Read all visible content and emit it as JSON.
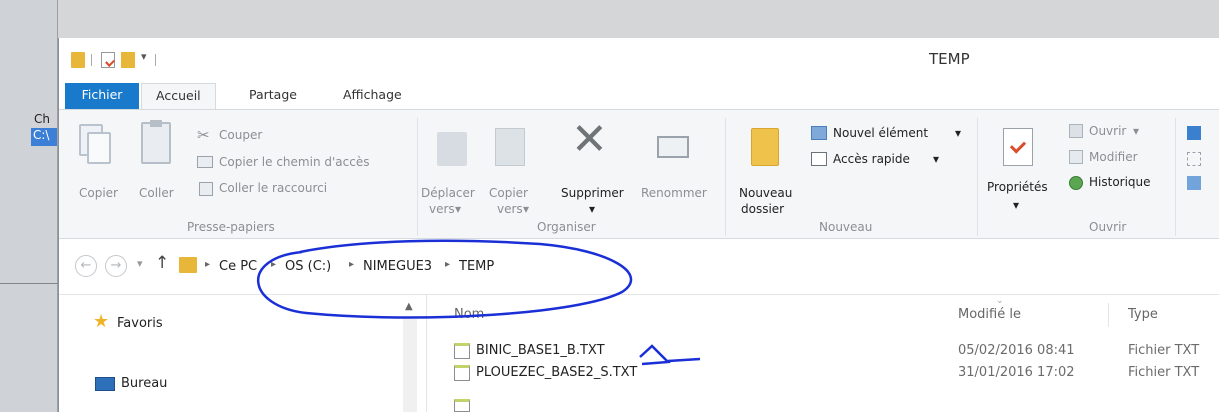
{
  "window": {
    "title": "TEMP"
  },
  "background_app": {
    "label": "Ch",
    "selected": "C:\\"
  },
  "tabs": [
    {
      "label": "Fichier"
    },
    {
      "label": "Accueil"
    },
    {
      "label": "Partage"
    },
    {
      "label": "Affichage"
    }
  ],
  "ribbon": {
    "clipboard": {
      "copy": "Copier",
      "paste": "Coller",
      "cut": "Couper",
      "copy_path": "Copier le chemin d'accès",
      "paste_shortcut": "Coller le raccourci",
      "group": "Presse-papiers"
    },
    "organize": {
      "move_line1": "Déplacer",
      "move_line2": "vers",
      "copy_line1": "Copier",
      "copy_line2": "vers",
      "delete": "Supprimer",
      "rename": "Renommer",
      "group": "Organiser"
    },
    "new": {
      "folder_line1": "Nouveau",
      "folder_line2": "dossier",
      "new_item": "Nouvel élément",
      "quick_access": "Accès rapide",
      "group": "Nouveau"
    },
    "open": {
      "properties": "Propriétés",
      "open": "Ouvrir",
      "edit": "Modifier",
      "history": "Historique",
      "group": "Ouvrir"
    }
  },
  "address": {
    "crumbs": [
      "Ce PC",
      "OS (C:)",
      "NIMEGUE3",
      "TEMP"
    ]
  },
  "nav": {
    "items": [
      {
        "label": "Favoris"
      },
      {
        "label": "Bureau"
      }
    ]
  },
  "file_list": {
    "columns": {
      "name": "Nom",
      "modified": "Modifié le",
      "type": "Type"
    },
    "rows": [
      {
        "name": "BINIC_BASE1_B.TXT",
        "modified": "05/02/2016 08:41",
        "type": "Fichier TXT"
      },
      {
        "name": "PLOUEZEC_BASE2_S.TXT",
        "modified": "31/01/2016 17:02",
        "type": "Fichier TXT"
      }
    ]
  },
  "colors": {
    "file_tab": "#1979ca",
    "annotation_ink": "#1a2fd6",
    "selection": "#3b7fd6"
  }
}
